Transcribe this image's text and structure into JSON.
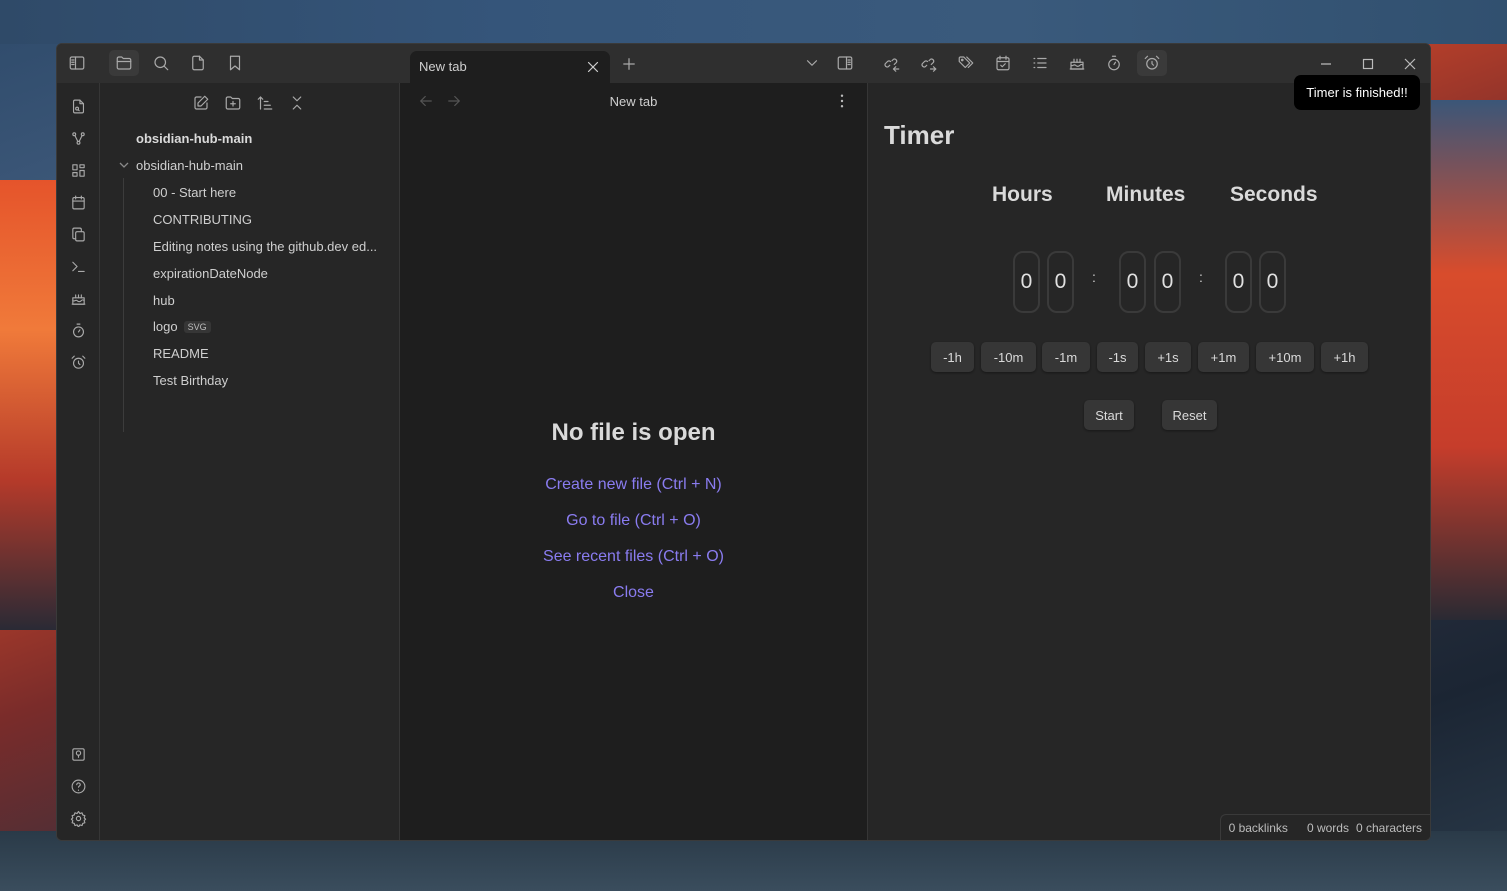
{
  "titlebar": {
    "left_icons": [
      "sidebar-toggle-icon",
      "folder-icon",
      "search-icon",
      "file-icon",
      "bookmark-icon"
    ],
    "tab": {
      "label": "New tab"
    },
    "new_tab_label": "+",
    "right_icons": [
      "backlinks-icon",
      "outgoing-links-icon",
      "tags-icon",
      "calendar-check-icon",
      "outline-list-icon",
      "birthday-cake-icon",
      "stopwatch-icon",
      "alarm-clock-icon"
    ]
  },
  "ribbon": {
    "top": [
      "file-search-icon",
      "graph-icon",
      "layout-dashboard-icon",
      "calendar-icon",
      "copy-icon",
      "terminal-icon",
      "cake-icon",
      "timer-icon",
      "alarm-icon"
    ],
    "bottom": [
      "vault-icon",
      "help-icon",
      "settings-icon"
    ]
  },
  "sidebar": {
    "vault_name": "obsidian-hub-main",
    "folder": "obsidian-hub-main",
    "items": [
      {
        "label": "00 - Start here"
      },
      {
        "label": "CONTRIBUTING"
      },
      {
        "label": "Editing notes using the github.dev ed..."
      },
      {
        "label": "expirationDateNode"
      },
      {
        "label": "hub"
      },
      {
        "label": "logo",
        "badge": "SVG"
      },
      {
        "label": "README"
      },
      {
        "label": "Test Birthday"
      }
    ]
  },
  "center": {
    "nav_title": "New tab",
    "empty_title": "No file is open",
    "links": [
      "Create new file (Ctrl + N)",
      "Go to file (Ctrl + O)",
      "See recent files (Ctrl + O)",
      "Close"
    ],
    "link_color": "#8a7cf0"
  },
  "timer": {
    "title": "Timer",
    "units": [
      "Hours",
      "Minutes",
      "Seconds"
    ],
    "digits": [
      "0",
      "0",
      "0",
      "0",
      "0",
      "0"
    ],
    "separator": ":",
    "adjust_buttons": [
      "-1h",
      "-10m",
      "-1m",
      "-1s",
      "+1s",
      "+1m",
      "+10m",
      "+1h"
    ],
    "start_label": "Start",
    "reset_label": "Reset"
  },
  "toast": {
    "message": "Timer is finished!!"
  },
  "status": {
    "backlinks": "0 backlinks",
    "words": "0 words",
    "characters": "0 characters"
  }
}
